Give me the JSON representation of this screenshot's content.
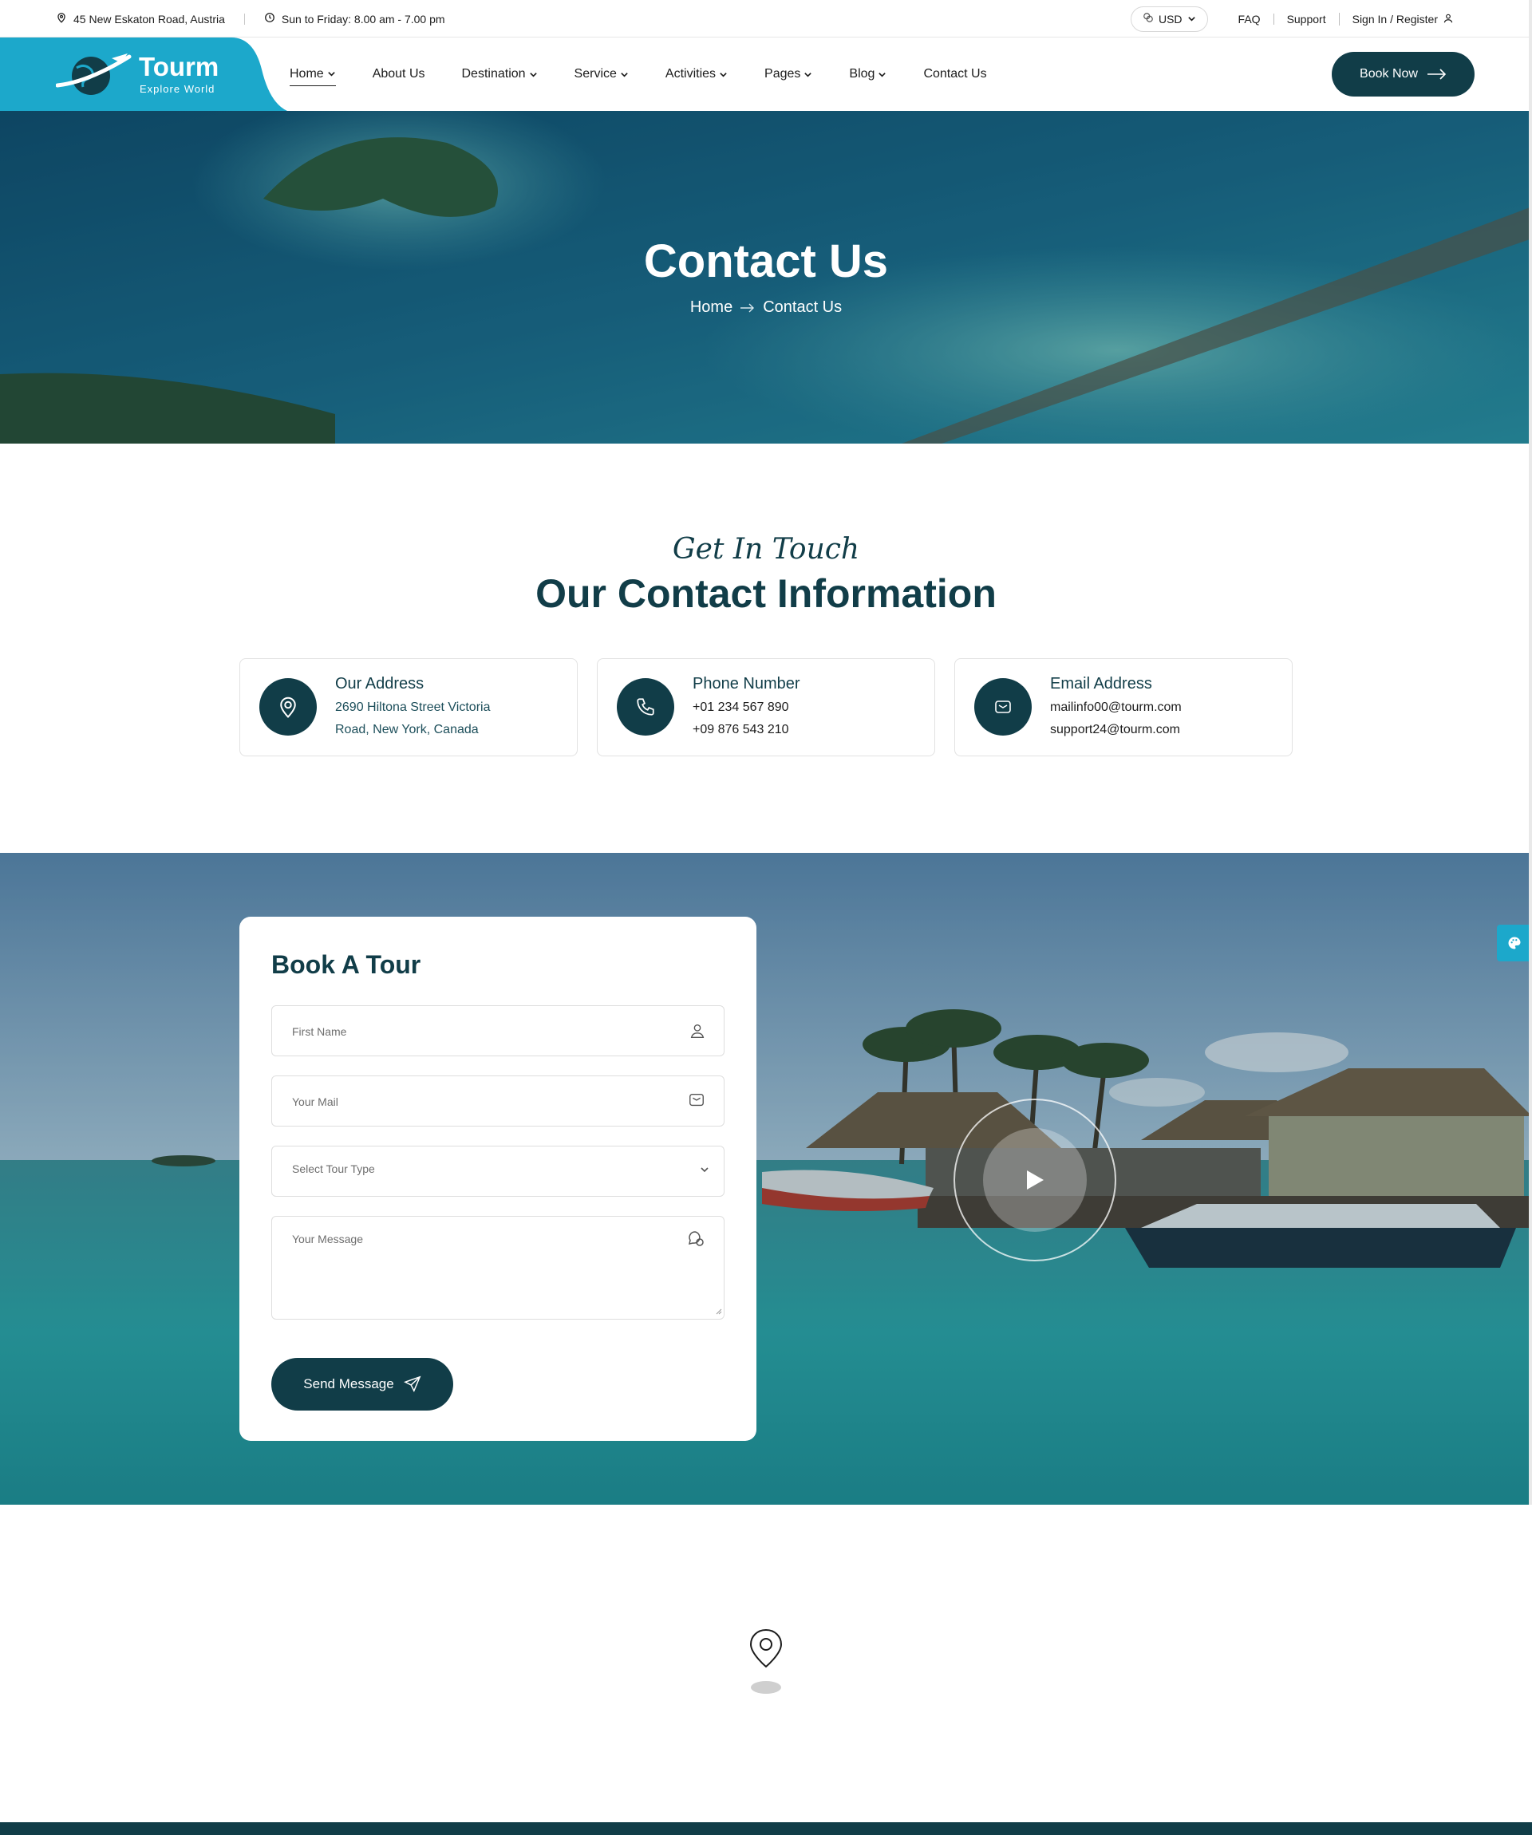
{
  "topbar": {
    "address": "45 New Eskaton Road, Austria",
    "hours": "Sun to Friday: 8.00 am - 7.00 pm",
    "currency": "USD",
    "faq": "FAQ",
    "support": "Support",
    "signin": "Sign In / Register"
  },
  "brand": {
    "name": "Tourm",
    "tagline": "Explore World",
    "primary_color": "#113d48",
    "accent_color": "#1ca8cb"
  },
  "nav": {
    "items": [
      {
        "label": "Home",
        "dropdown": true,
        "active": true
      },
      {
        "label": "About Us",
        "dropdown": false
      },
      {
        "label": "Destination",
        "dropdown": true
      },
      {
        "label": "Service",
        "dropdown": true
      },
      {
        "label": "Activities",
        "dropdown": true
      },
      {
        "label": "Pages",
        "dropdown": true
      },
      {
        "label": "Blog",
        "dropdown": true
      },
      {
        "label": "Contact Us",
        "dropdown": false
      }
    ],
    "book_now": "Book Now"
  },
  "hero": {
    "title": "Contact Us",
    "breadcrumb_home": "Home",
    "breadcrumb_current": "Contact Us"
  },
  "contact": {
    "eyebrow": "Get In Touch",
    "title": "Our Contact Information",
    "cards": [
      {
        "icon": "location-pin-icon",
        "title": "Our Address",
        "line1": "2690 Hiltona Street Victoria",
        "line2": "Road, New York, Canada"
      },
      {
        "icon": "phone-icon",
        "title": "Phone Number",
        "line1": "+01 234 567 890",
        "line2": "+09 876 543 210"
      },
      {
        "icon": "envelope-icon",
        "title": "Email Address",
        "line1": "mailinfo00@tourm.com",
        "line2": "support24@tourm.com"
      }
    ]
  },
  "booking": {
    "title": "Book A Tour",
    "first_name_placeholder": "First Name",
    "mail_placeholder": "Your Mail",
    "tour_type_placeholder": "Select Tour Type",
    "message_placeholder": "Your Message",
    "send_label": "Send Message"
  }
}
